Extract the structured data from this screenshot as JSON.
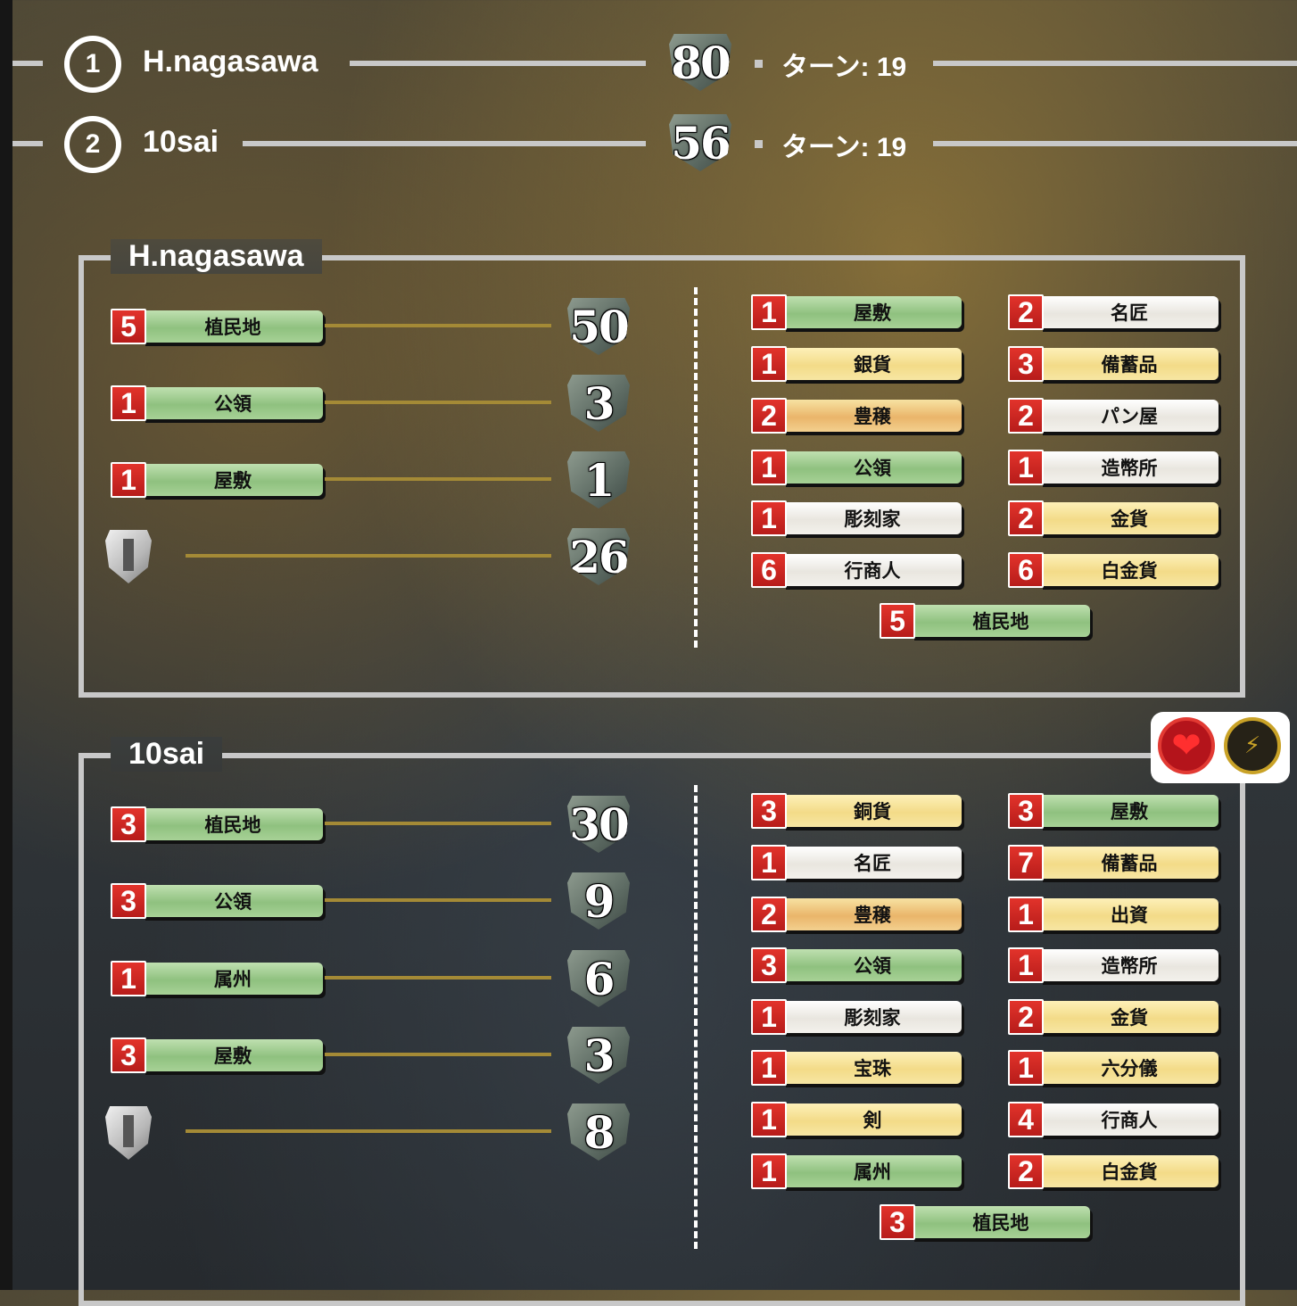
{
  "header": {
    "rows": [
      {
        "rank": "1",
        "name": "H.nagasawa",
        "score": "80",
        "turn": "ターン: 19"
      },
      {
        "rank": "2",
        "name": "10sai",
        "score": "56",
        "turn": "ターン: 19"
      }
    ]
  },
  "panels": [
    {
      "title": "H.nagasawa",
      "summary": [
        {
          "count": "5",
          "label": "植民地",
          "points": "50",
          "color": "g"
        },
        {
          "count": "1",
          "label": "公領",
          "points": "3",
          "color": "g"
        },
        {
          "count": "1",
          "label": "屋敷",
          "points": "1",
          "color": "g"
        }
      ],
      "summary_shield_points": "26",
      "cards": [
        {
          "count": "1",
          "label": "屋敷",
          "color": "g"
        },
        {
          "count": "2",
          "label": "名匠",
          "color": "w"
        },
        {
          "count": "1",
          "label": "銀貨",
          "color": "y"
        },
        {
          "count": "3",
          "label": "備蓄品",
          "color": "y"
        },
        {
          "count": "2",
          "label": "豊穣",
          "color": "o"
        },
        {
          "count": "2",
          "label": "パン屋",
          "color": "w"
        },
        {
          "count": "1",
          "label": "公領",
          "color": "g"
        },
        {
          "count": "1",
          "label": "造幣所",
          "color": "w"
        },
        {
          "count": "1",
          "label": "彫刻家",
          "color": "w"
        },
        {
          "count": "2",
          "label": "金貨",
          "color": "y"
        },
        {
          "count": "6",
          "label": "行商人",
          "color": "w"
        },
        {
          "count": "6",
          "label": "白金貨",
          "color": "y"
        }
      ],
      "center_card": {
        "count": "5",
        "label": "植民地",
        "color": "g"
      }
    },
    {
      "title": "10sai",
      "summary": [
        {
          "count": "3",
          "label": "植民地",
          "points": "30",
          "color": "g"
        },
        {
          "count": "3",
          "label": "公領",
          "points": "9",
          "color": "g"
        },
        {
          "count": "1",
          "label": "属州",
          "points": "6",
          "color": "g"
        },
        {
          "count": "3",
          "label": "屋敷",
          "points": "3",
          "color": "g"
        }
      ],
      "summary_shield_points": "8",
      "cards": [
        {
          "count": "3",
          "label": "銅貨",
          "color": "y"
        },
        {
          "count": "3",
          "label": "屋敷",
          "color": "g"
        },
        {
          "count": "1",
          "label": "名匠",
          "color": "w"
        },
        {
          "count": "7",
          "label": "備蓄品",
          "color": "y"
        },
        {
          "count": "2",
          "label": "豊穣",
          "color": "o"
        },
        {
          "count": "1",
          "label": "出資",
          "color": "y"
        },
        {
          "count": "3",
          "label": "公領",
          "color": "g"
        },
        {
          "count": "1",
          "label": "造幣所",
          "color": "w"
        },
        {
          "count": "1",
          "label": "彫刻家",
          "color": "w"
        },
        {
          "count": "2",
          "label": "金貨",
          "color": "y"
        },
        {
          "count": "1",
          "label": "宝珠",
          "color": "y"
        },
        {
          "count": "1",
          "label": "六分儀",
          "color": "y"
        },
        {
          "count": "1",
          "label": "剣",
          "color": "y"
        },
        {
          "count": "4",
          "label": "行商人",
          "color": "w"
        },
        {
          "count": "1",
          "label": "属州",
          "color": "g"
        },
        {
          "count": "2",
          "label": "白金貨",
          "color": "y"
        }
      ],
      "center_card": {
        "count": "3",
        "label": "植民地",
        "color": "g"
      }
    }
  ],
  "icons": {
    "heart": "heart-icon",
    "bolt": "lightning-icon",
    "heart_glyph": "❤",
    "bolt_glyph": "⚡"
  }
}
